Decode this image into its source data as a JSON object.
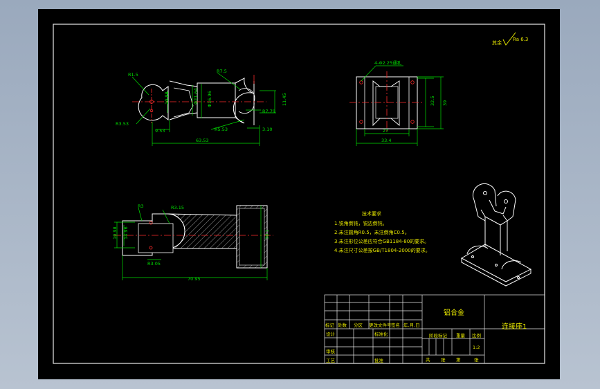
{
  "drawing": {
    "roughness_note": "其余",
    "roughness_value": "Ra 6.3",
    "front_view": {
      "dim_r1": "R1.5",
      "dim_r2": "R7.5",
      "dim_vertical_small": "10.98",
      "dim_dia_a": "Φ21.64",
      "dim_dia_b": "Φ16.96",
      "dim_right": "11.45",
      "dim_r3": "R3.53",
      "dim_gap": "9.53",
      "dim_r4": "R5.53",
      "dim_r5": "R7.79",
      "dim_small_right": "3.10",
      "dim_total": "63.53"
    },
    "top_view": {
      "hole_label": "4-Φ2.25通孔",
      "dim_inner_h": "32.5",
      "dim_outer_h": "39",
      "dim_inner_w": "27",
      "dim_outer_w": "33.4"
    },
    "section_view": {
      "dim_r1": "R3",
      "dim_r2": "R3.15",
      "dim_h1": "10.98",
      "dim_h2": "14.96",
      "dim_flange": "30.1",
      "dim_r3": "R3.05",
      "dim_total": "70.95"
    },
    "tech_req": {
      "title": "技术要求",
      "items": [
        "1.锐角倒钝，锐边倒钝。",
        "2.未注圆角R0.5，未注倒角C0.5。",
        "3.未注形位公差应符合GB1184-80的要求。",
        "4.未注尺寸公差按GB/T1804-2000的要求。"
      ]
    },
    "title_block": {
      "material": "铝合金",
      "part_name": "连接座1",
      "col_mark": "标记",
      "col_count": "处数",
      "col_zone": "分区",
      "col_doc": "更改文件号",
      "col_sign": "签名",
      "col_date": "年.月.日",
      "row_design": "设计",
      "row_standard": "标准化",
      "row_check": "审核",
      "row_process": "工艺",
      "row_approve": "批准",
      "stage_mark": "阶段标记",
      "weight": "重量",
      "scale": "比例",
      "scale_value": "1:2",
      "sheets_total": "共",
      "sheet_unit": "张",
      "sheet_no": "第",
      "sheet_unit2": "张"
    }
  }
}
